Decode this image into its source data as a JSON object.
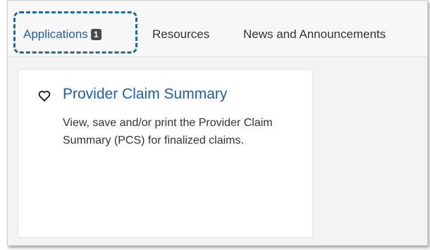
{
  "tabs": {
    "applications": {
      "label": "Applications",
      "badge": "1"
    },
    "resources": {
      "label": "Resources"
    },
    "news": {
      "label": "News and Announcements"
    }
  },
  "card": {
    "title": "Provider Claim Summary",
    "description": "View, save and/or print the Provider Claim Summary (PCS) for finalized claims.",
    "favorite_icon": "heart-outline-icon"
  },
  "colors": {
    "link": "#1a5fb4",
    "badge": "#4a4a4a",
    "focus_ring": "#1f6aa5"
  }
}
